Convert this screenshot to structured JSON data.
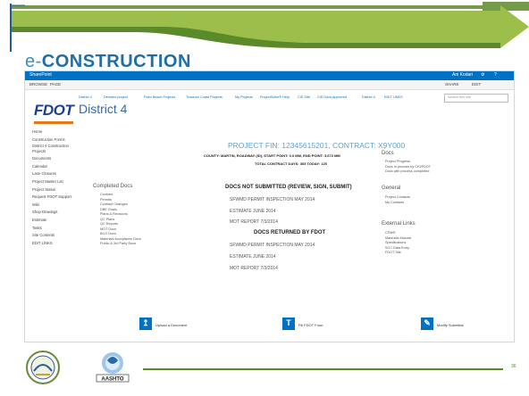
{
  "slide": {
    "title_prefix": "e-",
    "title_main": "CONSTRUCTION",
    "page_number": "36"
  },
  "sharepoint": {
    "brand": "SharePoint",
    "user": "Ani Kodari",
    "ribbon": {
      "browse": "BROWSE",
      "page": "PAGE",
      "share": "SHARE",
      "edit": "EDIT"
    },
    "search_placeholder": "Search this site",
    "logo_text": "FDOT",
    "district_title": "District 4",
    "top_nav": [
      "District 4",
      "Demand project",
      "Palm Beach Projects",
      "Treasure Coast Projects",
      "My Projects",
      "ProjectSolve® Help",
      "CIS Site",
      "CIS Docs Approved",
      "District 4",
      "EDIT LINKS"
    ],
    "left_nav": [
      "Home",
      "Construction Forms",
      "District 4 Construction Projects",
      "Documents",
      "Calendar",
      "Lane Closures",
      "Project Master List",
      "Project Status",
      "Request FDOT Support",
      "Wiki",
      "Shop Drawings",
      "Estimate",
      "Tasks",
      "Site Contents",
      "EDIT LINKS"
    ],
    "project_heading": "PROJECT FIN: 12345615201, CONTRACT: X9Y000",
    "county_line": "COUNTY: MARTIN, ROADWAY (ID), START POINT: 0.0 MM, END POINT: 3.672 MM",
    "total_line": "TOTAL CONTRACT DAYS: 365 TODAY: 125",
    "completed_docs_title": "Completed Docs",
    "completed_docs": [
      "Contract",
      "Permits",
      "Contract Changes",
      "DBE Goals",
      "Plans & Revisions",
      "QC Plans",
      "QC Reports",
      "MOT Docs",
      "BCO Docs",
      "Materials Acceptance Docs",
      "Public & 3rd Party Docs"
    ],
    "not_submitted_title": "DOCS NOT SUBMITTED (REVIEW, SIGN, SUBMIT)",
    "not_submitted_items": [
      "SFWMD PERMIT INSPECTION MAY 2014",
      "ESTIMATE JUNE 2014",
      "MOT REPORT 7/3/2014"
    ],
    "returned_title": "DOCS RETURNED BY FDOT",
    "returned_items": [
      "SFWMD PERMIT INSPECTION MAY 2014",
      "ESTIMATE JUNE 2014",
      "MOT REPORT 7/3/2014"
    ],
    "docs_title": "Docs",
    "docs_items": [
      "Project Progress",
      "Docs In process by CEI/FDOT",
      "Docs with process completed"
    ],
    "general_title": "General",
    "general_items": [
      "Project Contacts",
      "My Contacts"
    ],
    "external_title": "External Links",
    "external_items": [
      "CFM/E",
      "Materials Manual",
      "Specifications",
      "SCC Data Entry",
      "FDOT Site"
    ],
    "tiles": [
      {
        "label": "Upload a Document",
        "icon": "upload-icon"
      },
      {
        "label": "Fill FDOT Form",
        "icon": "form-icon"
      },
      {
        "label": "Modify Submittal",
        "icon": "edit-icon"
      }
    ]
  },
  "colors": {
    "banner_green": "#5b8a2a",
    "banner_blue": "#1f5f8b",
    "sharepoint_blue": "#0072c6",
    "title_blue": "#1f6fa6"
  }
}
